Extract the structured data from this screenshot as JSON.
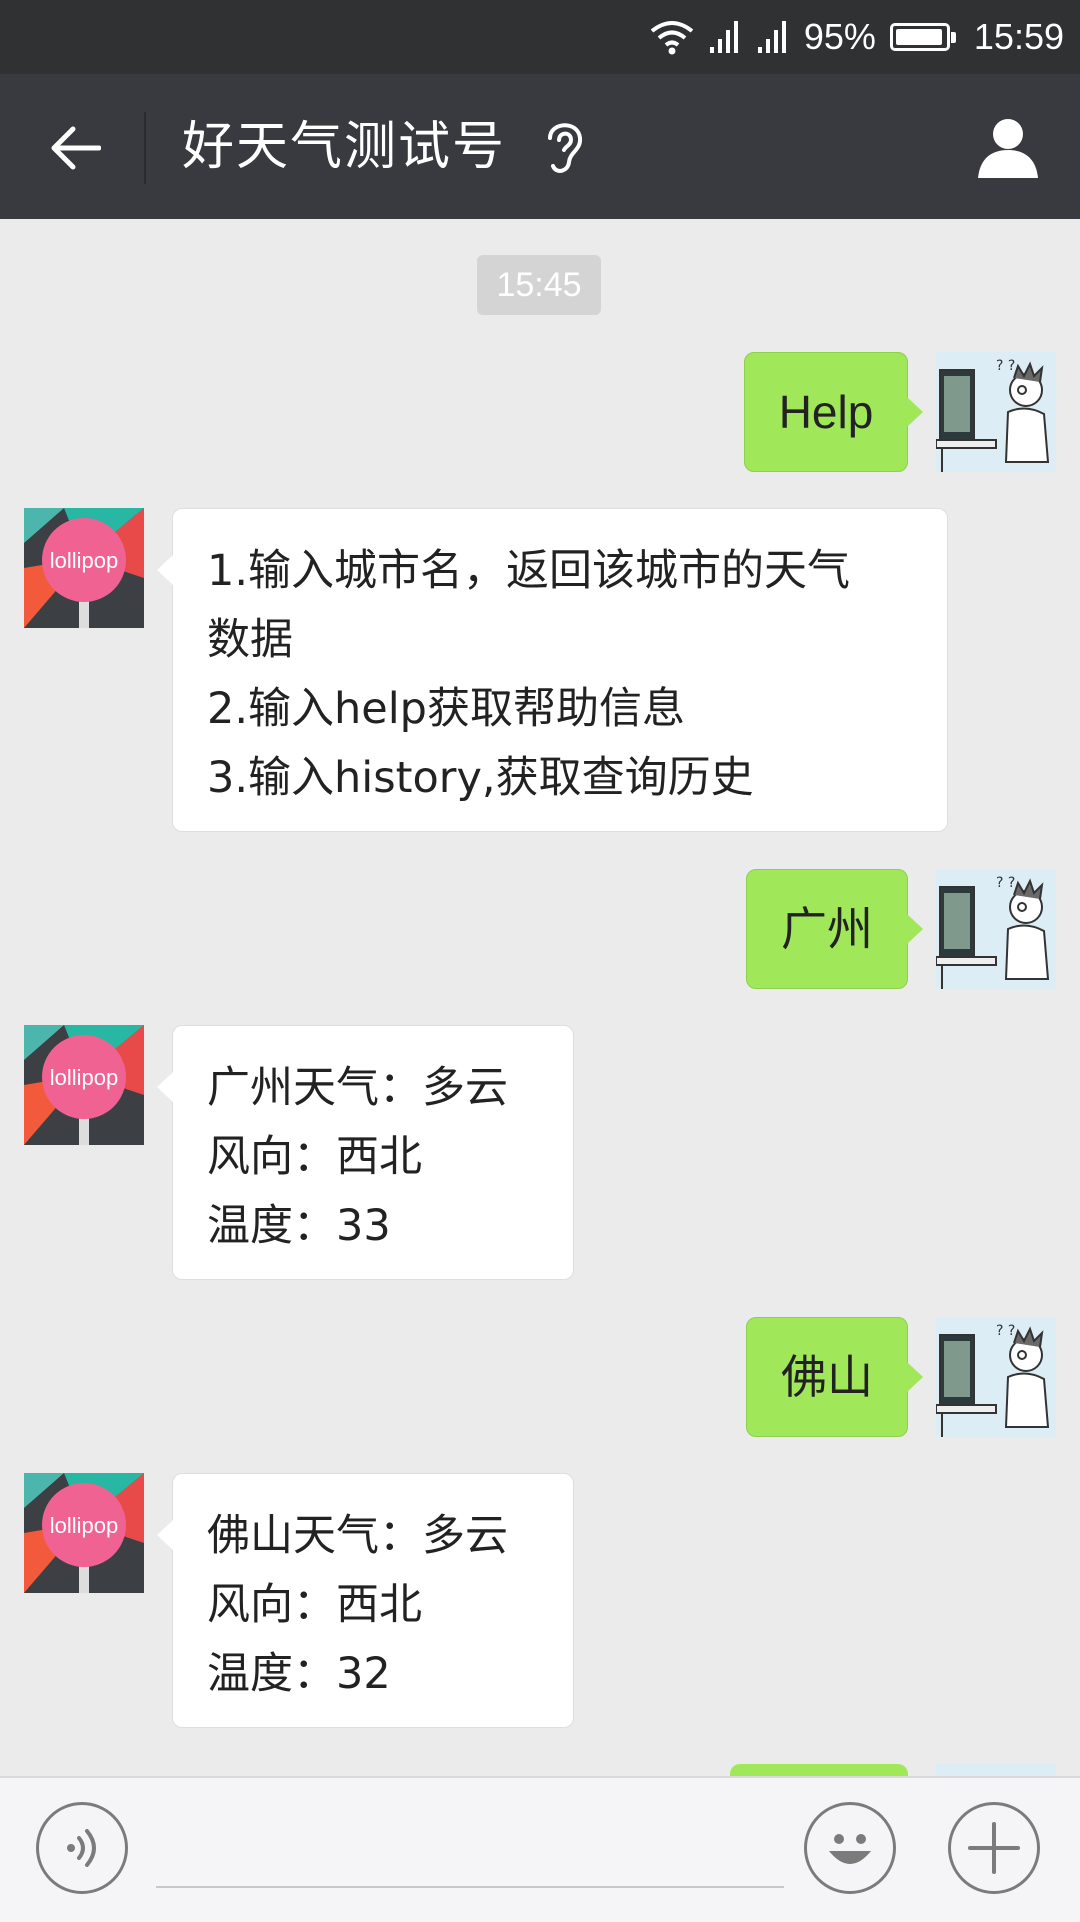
{
  "status_bar": {
    "battery_percent": "95%",
    "time": "15:59",
    "icons": [
      "wifi-icon",
      "signal-icon",
      "signal-icon",
      "battery-icon"
    ]
  },
  "header": {
    "title": "好天气测试号",
    "icons": [
      "back-arrow-icon",
      "ear-icon",
      "profile-icon"
    ]
  },
  "chat": {
    "timestamp": "15:45",
    "bot_avatar_text": "lollipop",
    "messages": [
      {
        "from": "user",
        "text": "Help"
      },
      {
        "from": "bot",
        "lines": [
          "1.输入城市名，返回该城市的天气",
          "数据",
          "2.输入help获取帮助信息",
          "3.输入history,获取查询历史"
        ]
      },
      {
        "from": "user",
        "text": "广州"
      },
      {
        "from": "bot",
        "lines": [
          "广州天气：多云",
          "风向：西北",
          "温度：33"
        ]
      },
      {
        "from": "user",
        "text": "佛山"
      },
      {
        "from": "bot",
        "lines": [
          "佛山天气：多云",
          "风向：西北",
          "温度：32"
        ]
      }
    ]
  },
  "input_bar": {
    "value": "",
    "icons": [
      "voice-icon",
      "emoji-icon",
      "plus-icon"
    ]
  },
  "colors": {
    "background": "#ebebeb",
    "header": "#393a3f",
    "status_bar": "#2f3133",
    "outgoing_bubble": "#a0e75a",
    "incoming_bubble": "#ffffff"
  }
}
